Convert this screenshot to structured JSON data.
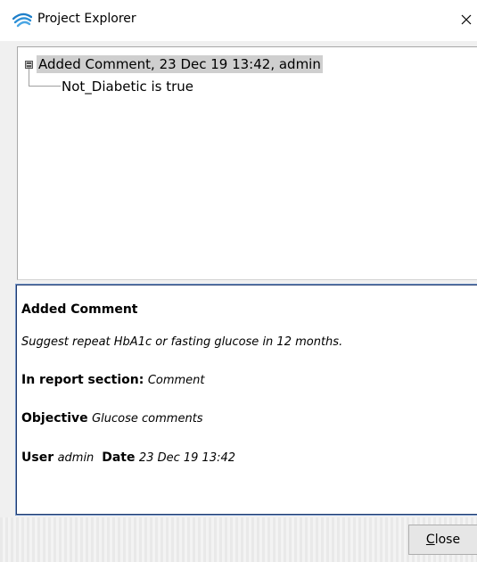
{
  "window": {
    "title": "Project Explorer",
    "close_glyph": "✕"
  },
  "tree": {
    "root": {
      "expander_state": "expanded",
      "label": "Added Comment, 23 Dec 19 13:42, admin",
      "children": [
        {
          "label": "Not_Diabetic is true"
        }
      ]
    }
  },
  "details": {
    "heading": "Added Comment",
    "comment_text": "Suggest repeat HbA1c or fasting glucose in 12 months.",
    "report_section_label": "In report section:",
    "report_section_value": "Comment",
    "objective_label": "Objective",
    "objective_value": "Glucose comments",
    "user_label": "User",
    "user_value": "admin",
    "date_label": "Date",
    "date_value": "23 Dec 19 13:42"
  },
  "footer": {
    "close_mnemonic": "C",
    "close_rest": "lose"
  },
  "colors": {
    "selection_bg": "#cfcfcf",
    "detail_border": "#1f3a6e",
    "icon_blue": "#2b8fd6"
  }
}
